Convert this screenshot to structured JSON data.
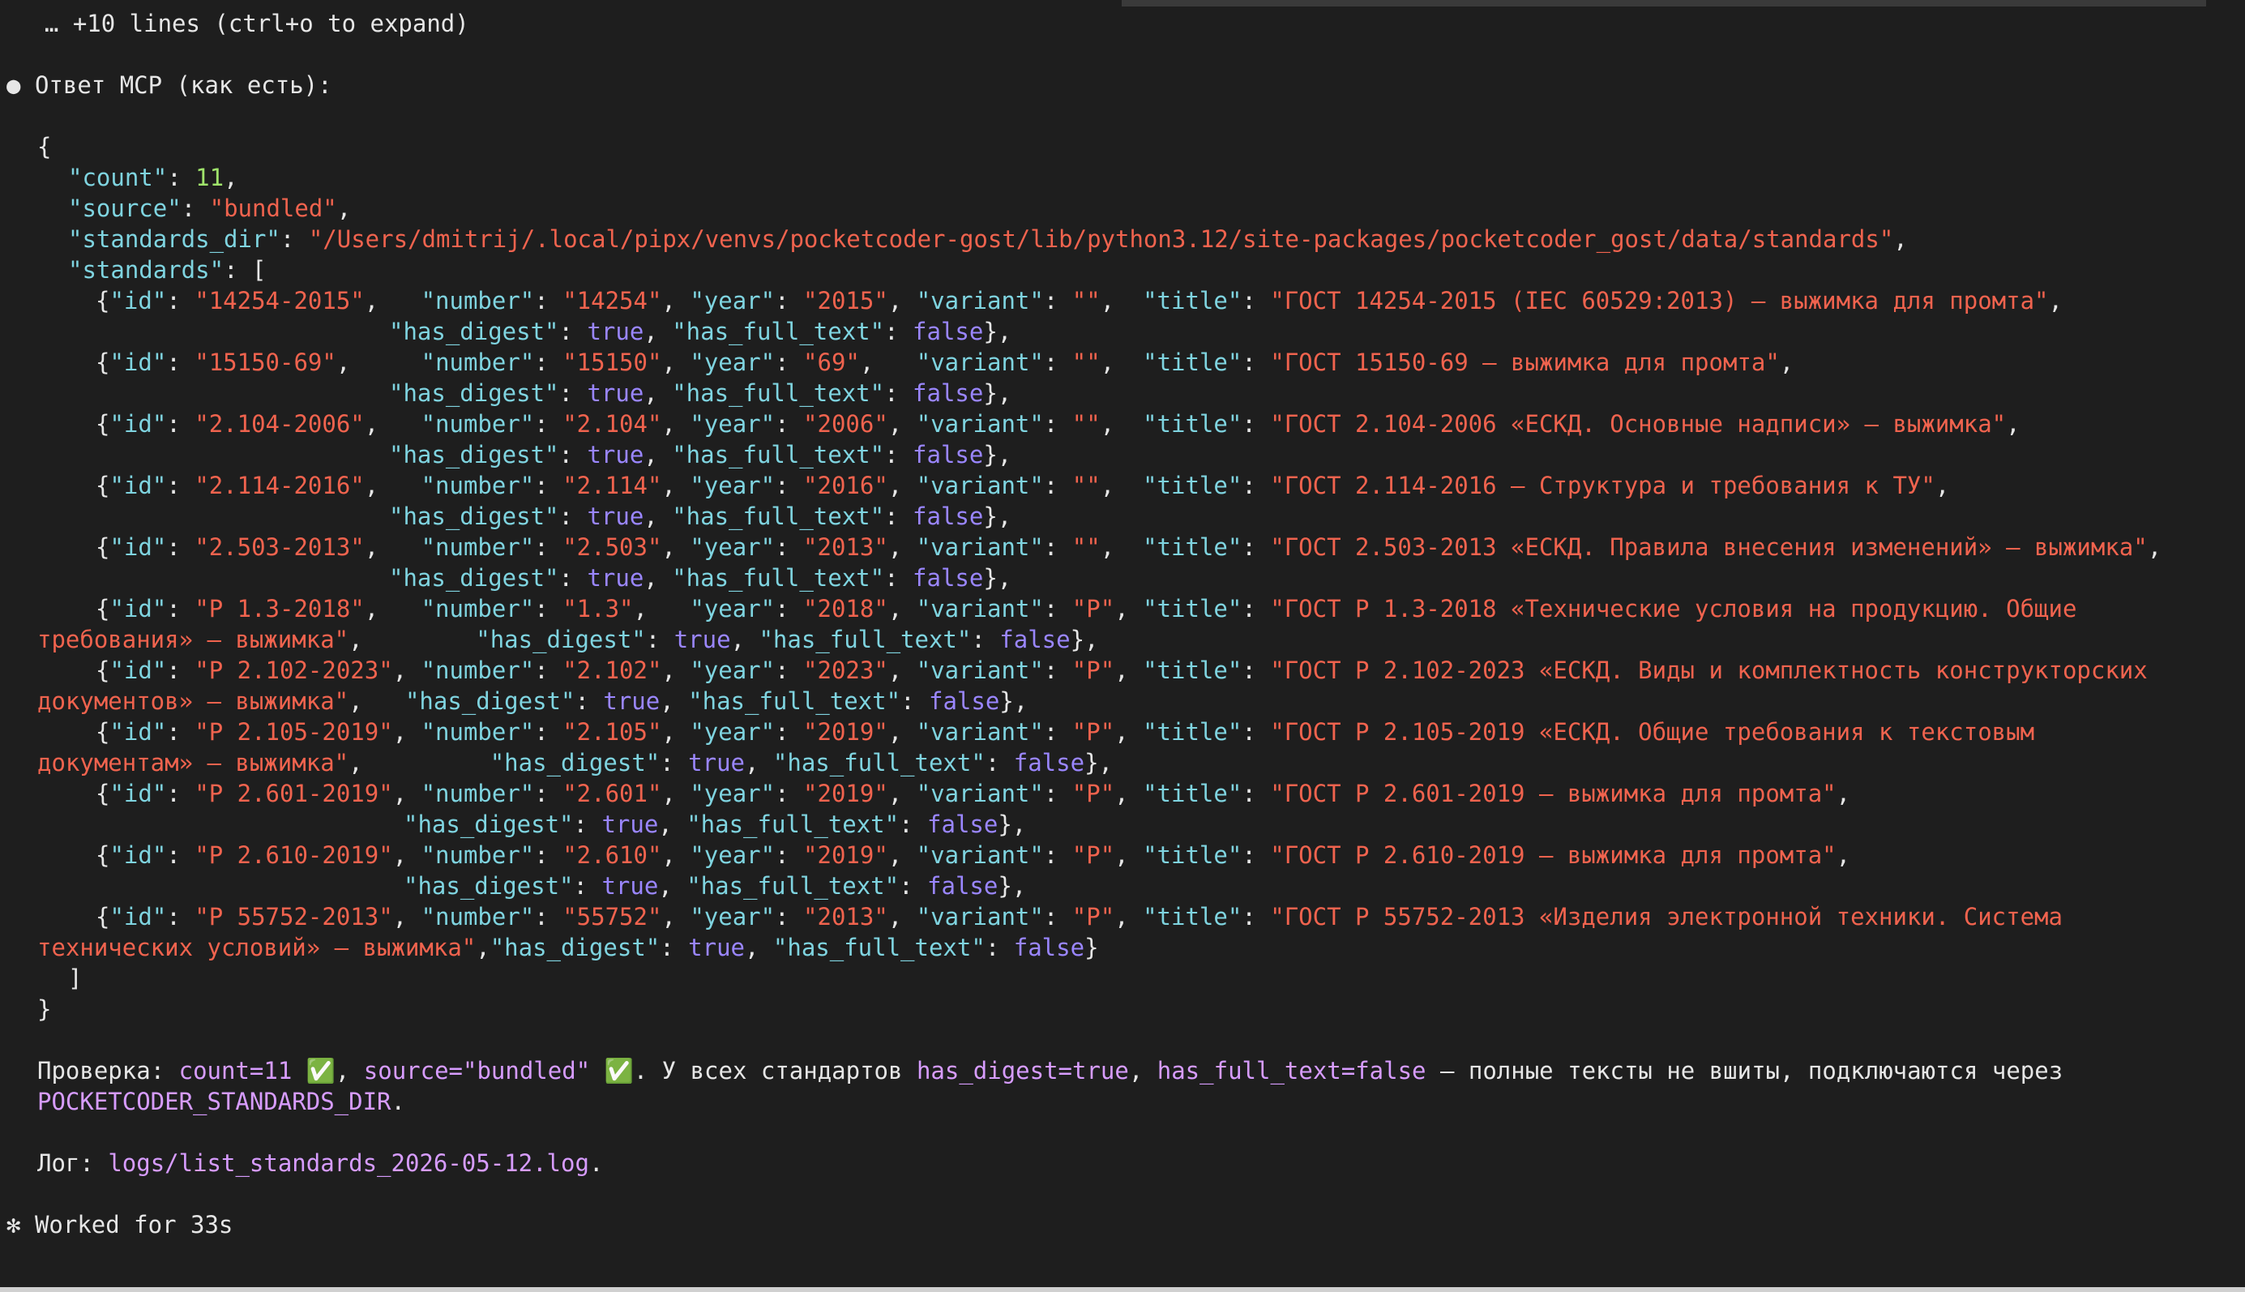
{
  "terminal": {
    "collapsed_hint": "  … +10 lines (ctrl+o to expand)",
    "bullet": "●",
    "response_header": "Ответ MCP (как есть):",
    "json_open": "{",
    "json_close": "}",
    "array_close": "]",
    "count_key": "\"count\"",
    "count_value": "11",
    "source_key": "\"source\"",
    "source_value": "\"bundled\"",
    "dir_key": "\"standards_dir\"",
    "dir_value": "\"/Users/dmitrij/.local/pipx/venvs/pocketcoder-gost/lib/python3.12/site-packages/pocketcoder_gost/data/standards\"",
    "standards_key": "\"standards\"",
    "array_open": "[",
    "standards": [
      {
        "id": "\"14254-2015\"",
        "number": "\"14254\"",
        "year": "\"2015\"",
        "variant": "\"\"",
        "title": "\"ГОСТ 14254-2015 (IEC 60529:2013) — выжимка для промта\""
      },
      {
        "id": "\"15150-69\"",
        "number": "\"15150\"",
        "year": "\"69\"",
        "variant": "\"\"",
        "title": "\"ГОСТ 15150-69 — выжимка для промта\""
      },
      {
        "id": "\"2.104-2006\"",
        "number": "\"2.104\"",
        "year": "\"2006\"",
        "variant": "\"\"",
        "title": "\"ГОСТ 2.104-2006 «ЕСКД. Основные надписи» — выжимка\""
      },
      {
        "id": "\"2.114-2016\"",
        "number": "\"2.114\"",
        "year": "\"2016\"",
        "variant": "\"\"",
        "title": "\"ГОСТ 2.114-2016 — Структура и требования к ТУ\""
      },
      {
        "id": "\"2.503-2013\"",
        "number": "\"2.503\"",
        "year": "\"2013\"",
        "variant": "\"\"",
        "title": "\"ГОСТ 2.503-2013 «ЕСКД. Правила внесения изменений» — выжимка\""
      },
      {
        "id": "\"Р 1.3-2018\"",
        "number": "\"1.3\"",
        "year": "\"2018\"",
        "variant": "\"Р\"",
        "title_a": "\"ГОСТ Р 1.3-2018 «Технические условия на продукцию. Общие",
        "title_b": "требования» — выжимка\""
      },
      {
        "id": "\"Р 2.102-2023\"",
        "number": "\"2.102\"",
        "year": "\"2023\"",
        "variant": "\"Р\"",
        "title_a": "\"ГОСТ Р 2.102-2023 «ЕСКД. Виды и комплектность конструкторских",
        "title_b": "документов» — выжимка\""
      },
      {
        "id": "\"Р 2.105-2019\"",
        "number": "\"2.105\"",
        "year": "\"2019\"",
        "variant": "\"Р\"",
        "title_a": "\"ГОСТ Р 2.105-2019 «ЕСКД. Общие требования к текстовым",
        "title_b": "документам» — выжимка\""
      },
      {
        "id": "\"Р 2.601-2019\"",
        "number": "\"2.601\"",
        "year": "\"2019\"",
        "variant": "\"Р\"",
        "title": "\"ГОСТ Р 2.601-2019 — выжимка для промта\""
      },
      {
        "id": "\"Р 2.610-2019\"",
        "number": "\"2.610\"",
        "year": "\"2019\"",
        "variant": "\"Р\"",
        "title": "\"ГОСТ Р 2.610-2019 — выжимка для промта\""
      },
      {
        "id": "\"Р 55752-2013\"",
        "number": "\"55752\"",
        "year": "\"2013\"",
        "variant": "\"Р\"",
        "title_a": "\"ГОСТ Р 55752-2013 «Изделия электронной техники. Система",
        "title_b": "технических условий» — выжимка\""
      }
    ],
    "key_id": "\"id\"",
    "key_number": "\"number\"",
    "key_year": "\"year\"",
    "key_variant": "\"variant\"",
    "key_title": "\"title\"",
    "key_has_digest": "\"has_digest\"",
    "key_has_full_text": "\"has_full_text\"",
    "val_true": "true",
    "val_false": "false",
    "check_label": "Проверка:",
    "check_count": "count=11",
    "check_source": "source=\"bundled\"",
    "check_mark": "✅",
    "check_text_1": "У всех стандартов",
    "check_digest": "has_digest=true",
    "check_full": "has_full_text=false",
    "check_text_2": "— полные тексты не вшиты, подключаются через",
    "check_env": "POCKETCODER_STANDARDS_DIR",
    "log_label": "Лог:",
    "log_path": "logs/list_standards_2026-05-12.log",
    "worked_icon": "✻",
    "worked_text": "Worked for 33s"
  },
  "colors": {
    "background": "#1e1e1e",
    "key": "#7fd4e0",
    "string": "#f0634e",
    "number": "#9fe36b",
    "boolean": "#9a86ff",
    "inline_code": "#d79cff"
  }
}
